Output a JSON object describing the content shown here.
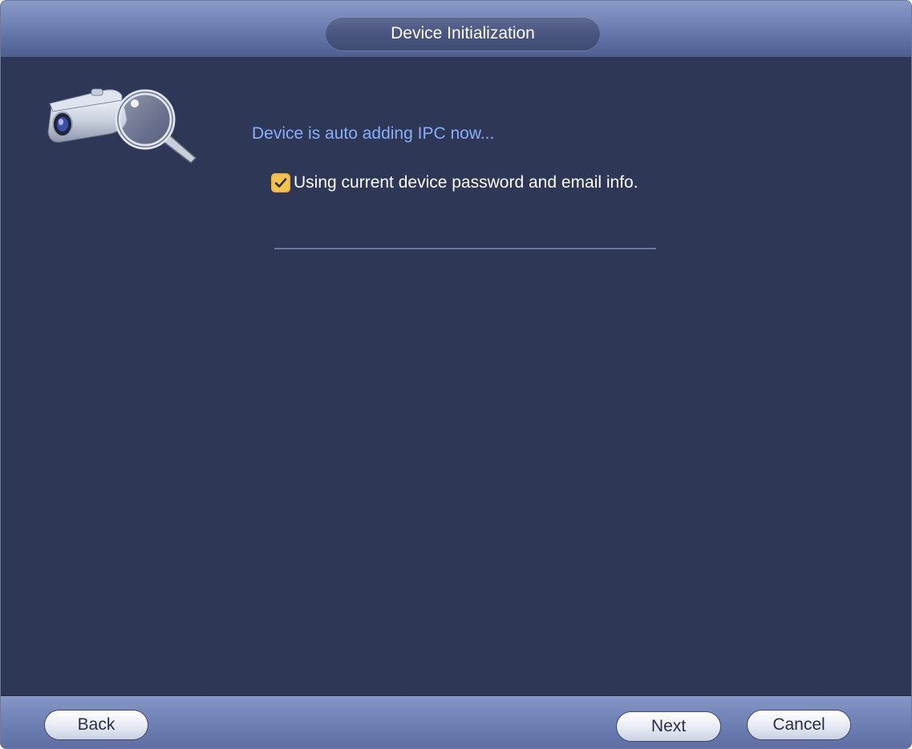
{
  "window": {
    "title": "Device Initialization"
  },
  "main": {
    "status_text": "Device is auto adding IPC now...",
    "option": {
      "label": "Using current device password and email info.",
      "checked": true
    },
    "progress": {
      "value": 0
    },
    "logo_icon": "camera-search-icon"
  },
  "footer": {
    "back_label": "Back",
    "next_label": "Next",
    "cancel_label": "Cancel"
  },
  "colors": {
    "background": "#2f3757",
    "accent_text": "#88aef8",
    "checkbox": "#f5c54a"
  }
}
